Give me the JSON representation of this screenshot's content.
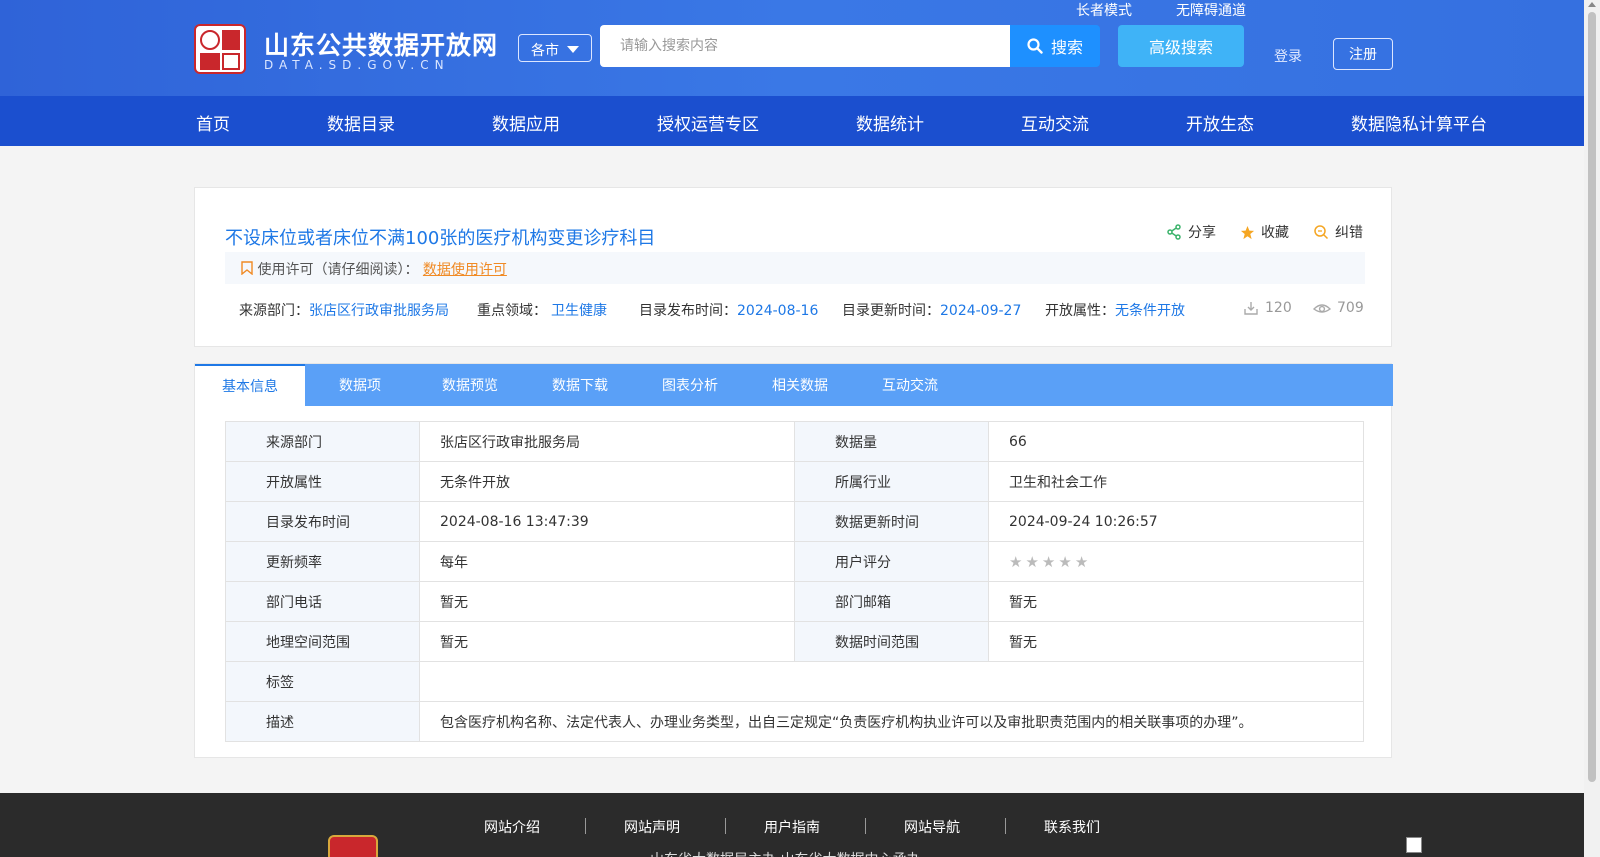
{
  "header": {
    "site_title": "山东公共数据开放网",
    "site_domain": "DATA.SD.GOV.CN",
    "city_select": "各市",
    "search_placeholder": "请输入搜索内容",
    "search_button": "搜索",
    "advanced_search": "高级搜索",
    "elder_mode": "长者模式",
    "accessible": "无障碍通道",
    "login": "登录",
    "register": "注册"
  },
  "nav": [
    "首页",
    "数据目录",
    "数据应用",
    "授权运营专区",
    "数据统计",
    "互动交流",
    "开放生态",
    "数据隐私计算平台"
  ],
  "dataset": {
    "title": "不设床位或者床位不满100张的医疗机构变更诊疗科目",
    "actions": {
      "share": "分享",
      "favorite": "收藏",
      "report": "纠错"
    },
    "license_label": "使用许可（请仔细阅读）：",
    "license_link": "数据使用许可",
    "meta": {
      "source_label": "来源部门：",
      "source_value": "张店区行政审批服务局",
      "field_label": "重点领域：",
      "field_value": "卫生健康",
      "publish_label": "目录发布时间：",
      "publish_value": "2024-08-16",
      "update_label": "目录更新时间：",
      "update_value": "2024-09-27",
      "open_label": "开放属性：",
      "open_value": "无条件开放",
      "downloads": "120",
      "views": "709"
    }
  },
  "tabs": [
    "基本信息",
    "数据项",
    "数据预览",
    "数据下载",
    "图表分析",
    "相关数据",
    "互动交流"
  ],
  "info": {
    "r1": {
      "k1": "来源部门",
      "v1": "张店区行政审批服务局",
      "k2": "数据量",
      "v2": "66"
    },
    "r2": {
      "k1": "开放属性",
      "v1": "无条件开放",
      "k2": "所属行业",
      "v2": "卫生和社会工作"
    },
    "r3": {
      "k1": "目录发布时间",
      "v1": "2024-08-16 13:47:39",
      "k2": "数据更新时间",
      "v2": "2024-09-24 10:26:57"
    },
    "r4": {
      "k1": "更新频率",
      "v1": "每年",
      "k2": "用户评分",
      "rating": 0
    },
    "r5": {
      "k1": "部门电话",
      "v1": "暂无",
      "k2": "部门邮箱",
      "v2": "暂无"
    },
    "r6": {
      "k1": "地理空间范围",
      "v1": "暂无",
      "k2": "数据时间范围",
      "v2": "暂无"
    },
    "r7": {
      "k1": "标签",
      "v1": ""
    },
    "r8": {
      "k1": "描述",
      "v1": "包含医疗机构名称、法定代表人、办理业务类型，出自三定规定“负责医疗机构执业许可以及审批职责范围内的相关联事项的办理”。"
    }
  },
  "footer": {
    "links": [
      "网站介绍",
      "网站声明",
      "用户指南",
      "网站导航",
      "联系我们"
    ],
    "note": "山东省大数据局主办    山东省大数据中心承办"
  },
  "colors": {
    "header_blue": "#2f63d8",
    "nav_blue": "#1b4fcf",
    "link_blue": "#1e78e6",
    "tab_blue": "#5aa0f7",
    "license_orange": "#f08a24"
  }
}
